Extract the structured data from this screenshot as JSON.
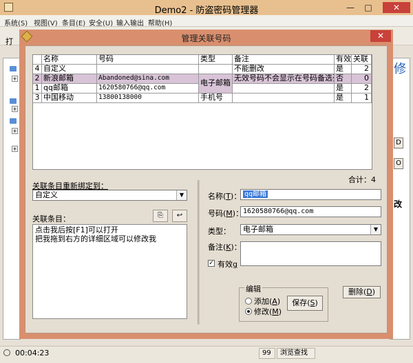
{
  "main": {
    "title": "Demo2 - 防盗密码管理器",
    "min_glyph": "—",
    "max_glyph": "□",
    "close_glyph": "✕",
    "menu": [
      "系统(S)",
      "视图(V)",
      "条目(E)",
      "安全(U)",
      "输入输出",
      "帮助(H)"
    ],
    "toolbar_label": "打",
    "right_glyphs": [
      "修",
      "D",
      "O",
      "改"
    ],
    "status": {
      "time": "00:04:23",
      "count": "99",
      "mode": "浏览查找"
    }
  },
  "dialog": {
    "title": "管理关联号码",
    "close_glyph": "✕",
    "table": {
      "headers": [
        "名称",
        "号码",
        "类型",
        "备注",
        "有效",
        "关联"
      ],
      "rows": [
        {
          "index": "4",
          "name": "自定义",
          "number": "",
          "type": "",
          "note": "不能删改",
          "valid": "是",
          "links": "2"
        },
        {
          "index": "2",
          "name": "新浪邮箱",
          "number": "Abandoned@sina.com",
          "type": "电子邮箱",
          "note": "无效号码不会显示在号码备选列",
          "valid": "否",
          "links": "0"
        },
        {
          "index": "1",
          "name": "qq邮箱",
          "number": "1620580766@qq.com",
          "type": "",
          "note": "",
          "valid": "是",
          "links": "2"
        },
        {
          "index": "3",
          "name": "中国移动",
          "number": "13800138000",
          "type": "手机号",
          "note": "",
          "valid": "是",
          "links": "1"
        }
      ]
    },
    "total_label": "合计：4",
    "rebind": {
      "label": "关联条目重新绑定到：",
      "value": "自定义",
      "arrow": "▼"
    },
    "linked": {
      "label": "关联条目：",
      "copy_glyph": "⎘",
      "back_glyph": "↩",
      "hint_lines": [
        "点击我后按[F1]可以打开",
        "把我拖到右方的详细区域可以修改我"
      ]
    },
    "detail": {
      "name_label": "名称(",
      "name_key": "T",
      "name_suffix": ")：",
      "name_value": "qq邮箱",
      "number_label": "号码(",
      "number_key": "M",
      "number_suffix": ")：",
      "number_value": "1620580766@qq.com",
      "type_label": "类型：",
      "type_value": "电子邮箱",
      "type_arrow": "▼",
      "note_label": "备注(",
      "note_key": "K",
      "note_suffix": ")：",
      "note_value": "",
      "valid_label": "有效",
      "valid_key": "g",
      "valid_checked": "✓"
    },
    "edit": {
      "group_label": "编辑",
      "add_label": "添加(",
      "add_key": "A",
      "add_suffix": ")",
      "modify_label": "修改(",
      "modify_key": "M",
      "modify_suffix": ")",
      "mode": "modify",
      "save_label": "保存(",
      "save_key": "S",
      "save_suffix": ")",
      "delete_label": "删除(",
      "delete_key": "D",
      "delete_suffix": ")"
    }
  }
}
